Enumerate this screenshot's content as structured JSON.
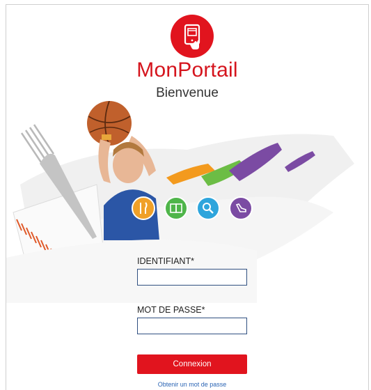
{
  "app": {
    "title": "MonPortail",
    "subtitle": "Bienvenue",
    "brand_color": "#e1141e"
  },
  "login": {
    "username_label": "IDENTIFIANT*",
    "username_value": "",
    "password_label": "MOT DE PASSE*",
    "password_value": "",
    "submit_label": "Connexion",
    "forgot_link": "Obtenir un mot de passe"
  },
  "categories": [
    {
      "icon": "fork-knife-icon",
      "color": "#f0a028"
    },
    {
      "icon": "book-icon",
      "color": "#4fb54a"
    },
    {
      "icon": "magnifier-icon",
      "color": "#2ea5dc"
    },
    {
      "icon": "shoe-icon",
      "color": "#7b4ba3"
    }
  ]
}
